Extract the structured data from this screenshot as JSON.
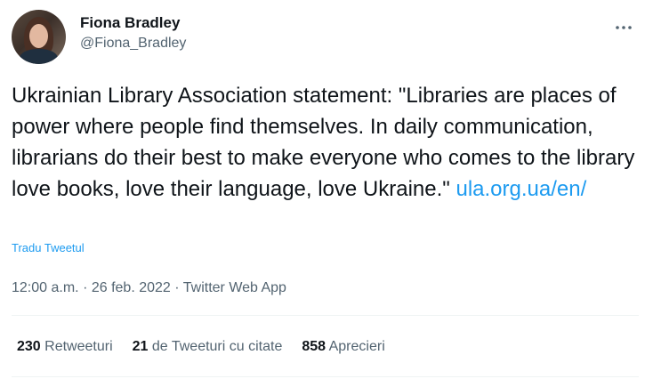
{
  "author": {
    "display_name": "Fiona Bradley",
    "handle": "@Fiona_Bradley"
  },
  "tweet": {
    "text": "Ukrainian Library Association statement: \"Libraries are places of power where people find themselves. In daily communication, librarians do their best to make everyone who comes to the library love books, love their language, love Ukraine.\" ",
    "link": "ula.org.ua/en/",
    "translate_label": "Tradu Tweetul"
  },
  "meta": {
    "time": "12:00 a.m.",
    "separator": "·",
    "date": "26 feb. 2022",
    "source": "Twitter Web App"
  },
  "stats": {
    "retweets": {
      "count": "230",
      "label": "Retweeturi"
    },
    "quotes": {
      "count": "21",
      "label": "de Tweeturi cu citate"
    },
    "likes": {
      "count": "858",
      "label": "Aprecieri"
    }
  },
  "colors": {
    "link": "#1d9bf0",
    "text": "#0f1419",
    "secondary": "#536471"
  },
  "icons": {
    "more": "more-horizontal-icon"
  }
}
